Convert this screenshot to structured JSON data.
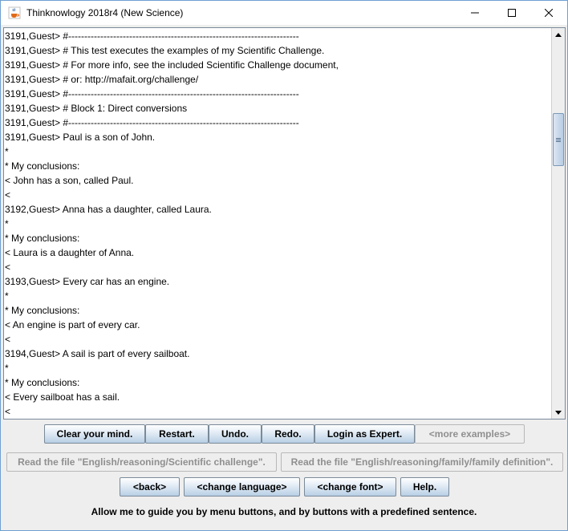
{
  "window": {
    "title": "Thinknowlogy 2018r4 (New Science)"
  },
  "output": {
    "lines": [
      "3191,Guest> #------------------------------------------------------------------------",
      "3191,Guest> # This test executes the examples of my Scientific Challenge.",
      "3191,Guest> # For more info, see the included Scientific Challenge document,",
      "3191,Guest> # or: http://mafait.org/challenge/",
      "3191,Guest> #------------------------------------------------------------------------",
      "3191,Guest> # Block 1: Direct conversions",
      "3191,Guest> #------------------------------------------------------------------------",
      "3191,Guest> Paul is a son of John.",
      "*",
      "* My conclusions:",
      "< John has a son, called Paul.",
      "<",
      "3192,Guest> Anna has a daughter, called Laura.",
      "*",
      "* My conclusions:",
      "< Laura is a daughter of Anna.",
      "<",
      "3193,Guest> Every car has an engine.",
      "*",
      "* My conclusions:",
      "< An engine is part of every car.",
      "<",
      "3194,Guest> A sail is part of every sailboat.",
      "*",
      "* My conclusions:",
      "< Every sailboat has a sail.",
      "<"
    ]
  },
  "buttons": {
    "row1": {
      "clear": "Clear your mind.",
      "restart": "Restart.",
      "undo": "Undo.",
      "redo": "Redo.",
      "login": "Login as Expert.",
      "more": "<more examples>"
    },
    "row2": {
      "read1": "Read the file \"English/reasoning/Scientific challenge\".",
      "read2": "Read the file \"English/reasoning/family/family definition\"."
    },
    "row3": {
      "back": "<back>",
      "language": "<change language>",
      "font": "<change font>",
      "help": "Help."
    }
  },
  "footer": {
    "message": "Allow me to guide you by menu buttons, and by buttons with a predefined sentence."
  }
}
